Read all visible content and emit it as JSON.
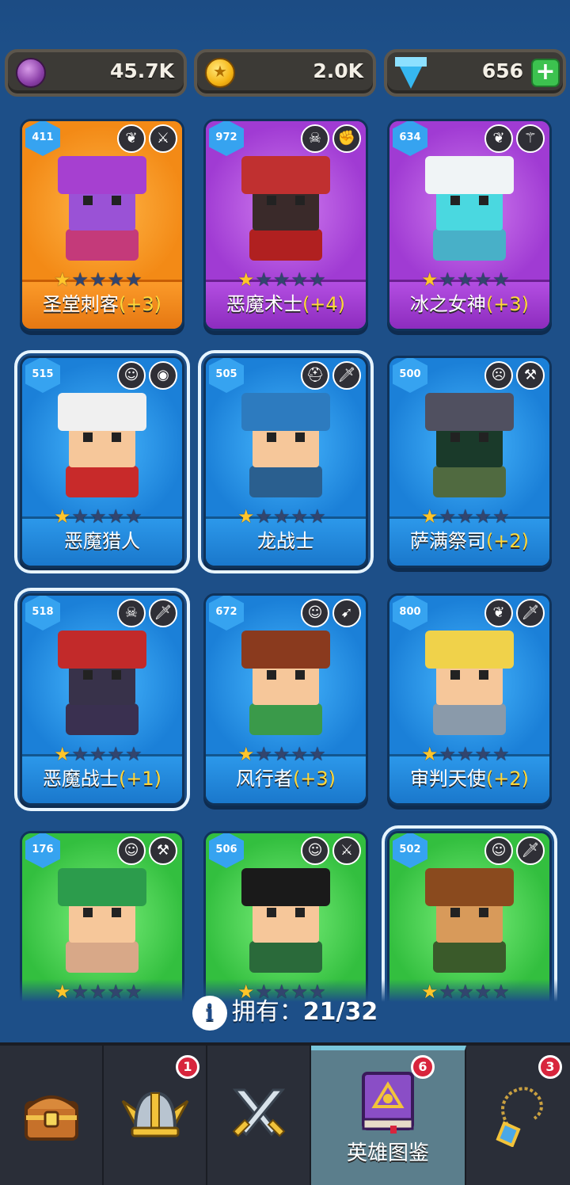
{
  "resources": {
    "elixir": {
      "value": "45.7K",
      "icon": "purple-coin-icon"
    },
    "gold": {
      "value": "2.0K",
      "icon": "gold-coin-icon"
    },
    "gems": {
      "value": "656",
      "icon": "gem-icon",
      "add": "+"
    }
  },
  "heroes": [
    {
      "level": "411",
      "name": "圣堂刺客",
      "bonus": "(+3)",
      "rarity": "orange",
      "stars": 1,
      "hair": "#a640d0",
      "skin": "#9a52d6",
      "body": "#c43a7a"
    },
    {
      "level": "972",
      "name": "恶魔术士",
      "bonus": "(+4)",
      "rarity": "purple",
      "stars": 1,
      "hair": "#c03030",
      "skin": "#3a2a2a",
      "body": "#b02020"
    },
    {
      "level": "634",
      "name": "冰之女神",
      "bonus": "(+3)",
      "rarity": "purple",
      "stars": 1,
      "hair": "#f0f4f6",
      "skin": "#4ad8e0",
      "body": "#48b0c8"
    },
    {
      "level": "515",
      "name": "恶魔猎人",
      "bonus": "",
      "rarity": "blue",
      "stars": 1,
      "hair": "#f0f0f0",
      "skin": "#f6c79a",
      "body": "#c82a2a"
    },
    {
      "level": "505",
      "name": "龙战士",
      "bonus": "",
      "rarity": "blue",
      "stars": 1,
      "hair": "#2d7bbf",
      "skin": "#f6c79a",
      "body": "#2a5f8f"
    },
    {
      "level": "500",
      "name": "萨满祭司",
      "bonus": "(+2)",
      "rarity": "blue",
      "stars": 1,
      "hair": "#505060",
      "skin": "#1a3a2a",
      "body": "#506a40"
    },
    {
      "level": "518",
      "name": "恶魔战士",
      "bonus": "(+1)",
      "rarity": "blue",
      "stars": 1,
      "hair": "#c22a2a",
      "skin": "#38324a",
      "body": "#3a3050"
    },
    {
      "level": "672",
      "name": "风行者",
      "bonus": "(+3)",
      "rarity": "blue",
      "stars": 1,
      "hair": "#8a3a1e",
      "skin": "#f6c79a",
      "body": "#3a9a4a"
    },
    {
      "level": "800",
      "name": "审判天使",
      "bonus": "(+2)",
      "rarity": "blue",
      "stars": 1,
      "hair": "#f0d24a",
      "skin": "#f6c79a",
      "body": "#8a9aaa"
    },
    {
      "level": "176",
      "name": "",
      "bonus": "",
      "rarity": "green",
      "stars": 1,
      "hair": "#2c9c4c",
      "skin": "#f6c79a",
      "body": "#d8a888"
    },
    {
      "level": "506",
      "name": "",
      "bonus": "",
      "rarity": "green",
      "stars": 1,
      "hair": "#1a1a1a",
      "skin": "#f6c79a",
      "body": "#2a6a3a"
    },
    {
      "level": "502",
      "name": "",
      "bonus": "",
      "rarity": "green",
      "stars": 1,
      "hair": "#8a4a1e",
      "skin": "#d89a5a",
      "body": "#3a5a2a"
    }
  ],
  "owned": {
    "label": "拥有：",
    "count": "21/32",
    "icon": "info-icon",
    "icon_glyph": "i"
  },
  "nav": {
    "tabs": [
      {
        "name": "chest",
        "icon": "treasure-chest-icon",
        "badge": ""
      },
      {
        "name": "heroes",
        "icon": "winged-helmet-icon",
        "badge": "1"
      },
      {
        "name": "battle",
        "icon": "crossed-swords-icon",
        "badge": ""
      },
      {
        "name": "codex",
        "icon": "hero-book-icon",
        "label": "英雄图鉴",
        "badge": "6"
      },
      {
        "name": "equipment",
        "icon": "amulet-icon",
        "badge": "3"
      }
    ]
  }
}
